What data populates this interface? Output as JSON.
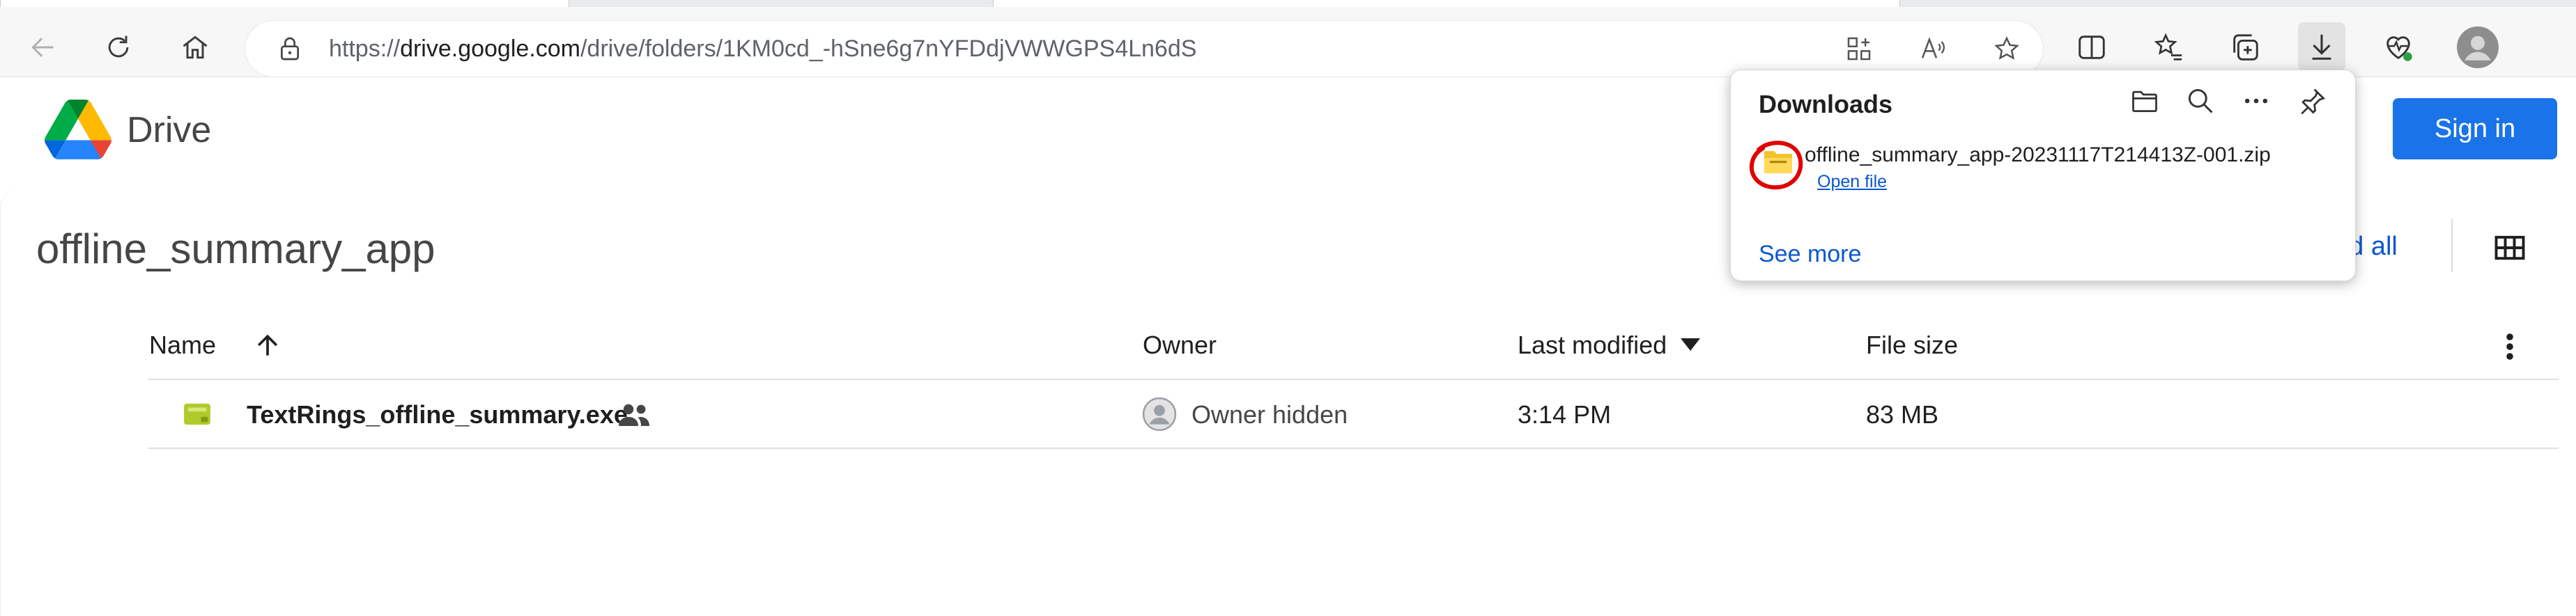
{
  "browser": {
    "url_prefix": "https://",
    "url_domain": "drive.google.com",
    "url_path": "/drive/folders/1KM0cd_-hSne6g7nYFDdjVWWGPS4Ln6dS"
  },
  "drive": {
    "app_name": "Drive",
    "sign_in_label": "Sign in",
    "folder_title": "offline_summary_app",
    "download_all_label": "ad all"
  },
  "table": {
    "headers": {
      "name": "Name",
      "owner": "Owner",
      "last_modified": "Last modified",
      "file_size": "File size"
    },
    "rows": [
      {
        "name": "TextRings_offline_summary.exe",
        "owner": "Owner hidden",
        "last_modified": "3:14 PM",
        "file_size": "83 MB"
      }
    ]
  },
  "downloads": {
    "title": "Downloads",
    "items": [
      {
        "filename": "offline_summary_app-20231117T214413Z-001.zip",
        "action_label": "Open file"
      }
    ],
    "see_more_label": "See more"
  },
  "colors": {
    "accent": "#1a73e8",
    "link": "#0b57d0",
    "highlight_annotation": "#e00000"
  }
}
